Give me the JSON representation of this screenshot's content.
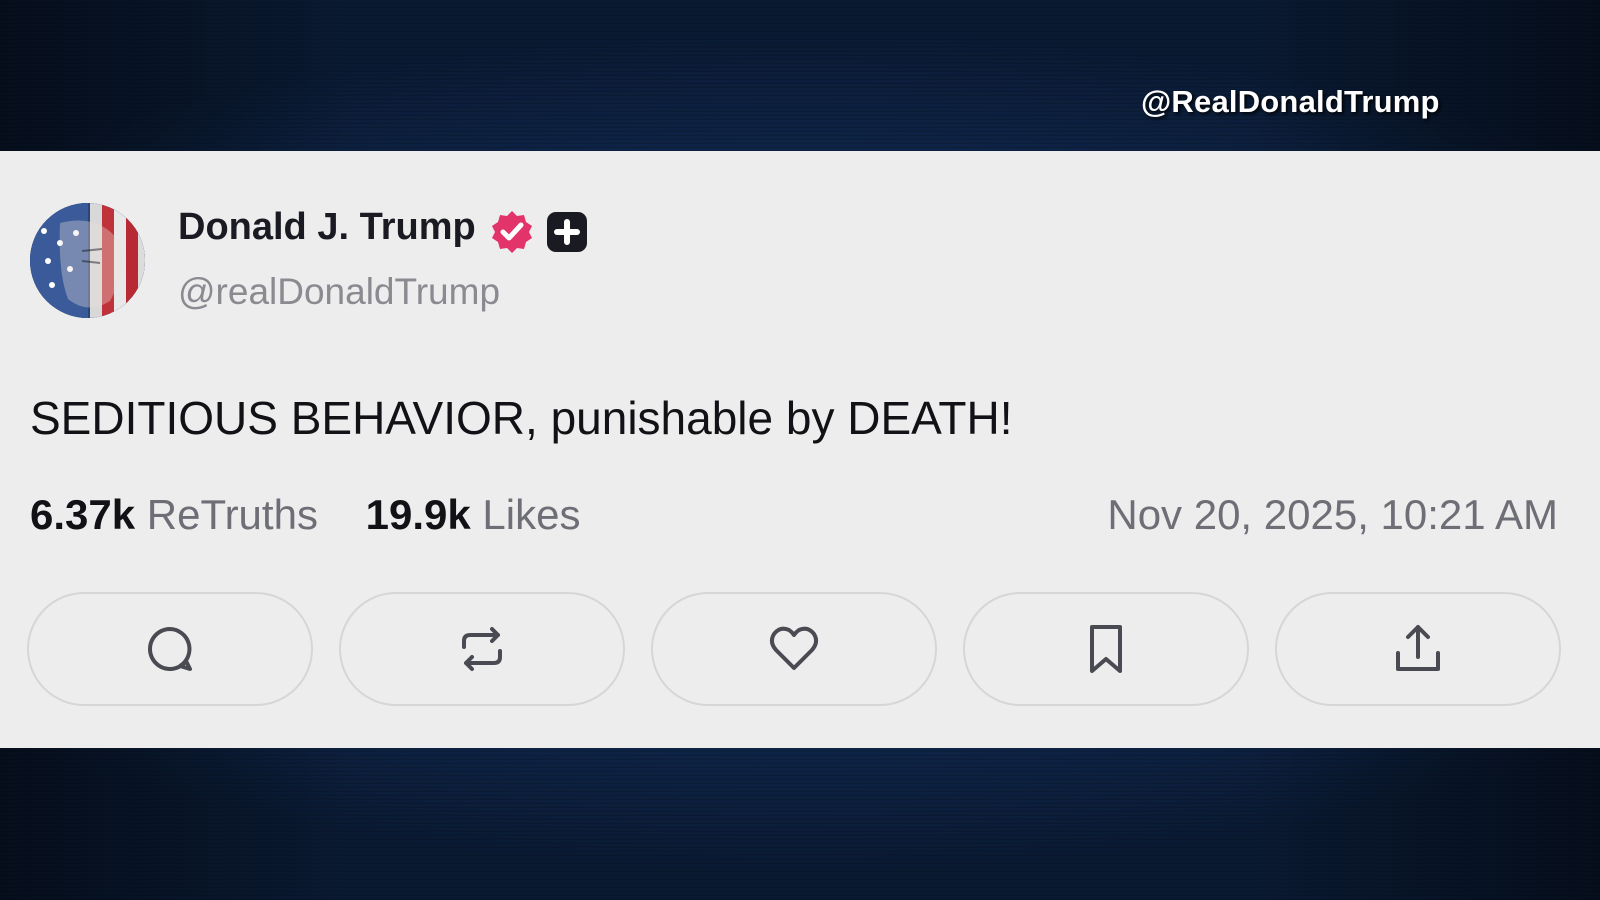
{
  "overlay": {
    "watermark": "@RealDonaldTrump"
  },
  "post": {
    "author": {
      "display_name": "Donald J. Trump",
      "handle": "@realDonaldTrump",
      "verified_badge_color": "#e2336b",
      "plus_badge_color": "#1a1a22"
    },
    "text": "SEDITIOUS BEHAVIOR, punishable by DEATH!",
    "stats": {
      "retruths_count": "6.37k",
      "retruths_label": "ReTruths",
      "likes_count": "19.9k",
      "likes_label": "Likes"
    },
    "timestamp": "Nov 20, 2025, 10:21 AM",
    "actions": [
      {
        "icon": "reply-icon"
      },
      {
        "icon": "retruth-icon"
      },
      {
        "icon": "heart-icon"
      },
      {
        "icon": "bookmark-icon"
      },
      {
        "icon": "share-icon"
      }
    ]
  },
  "colors": {
    "background": "#102a52",
    "card": "#ededed",
    "text_primary": "#121216",
    "text_secondary": "#6e6e76"
  }
}
